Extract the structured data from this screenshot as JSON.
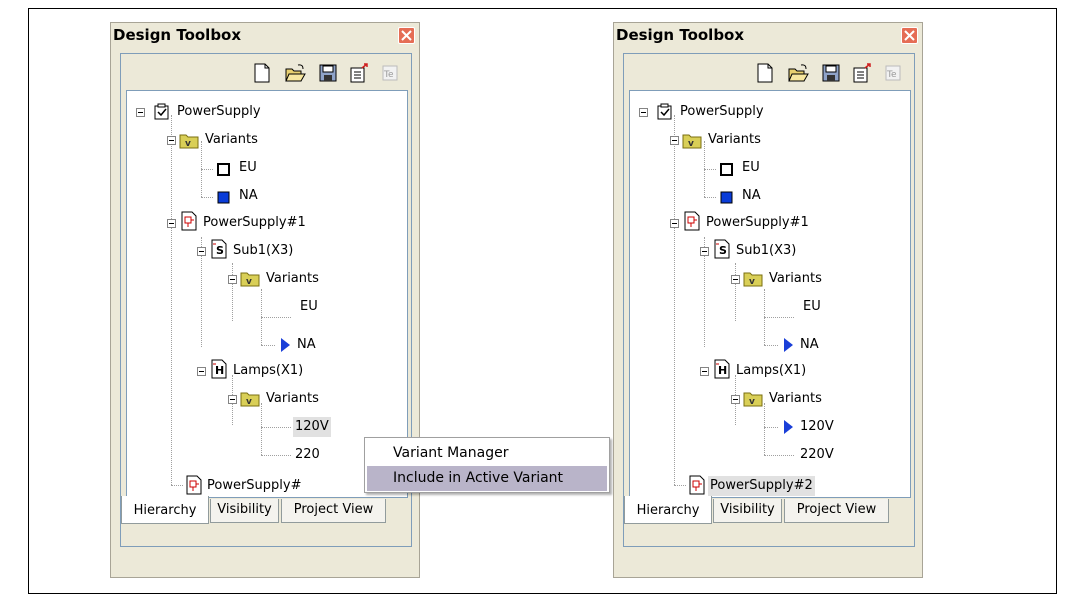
{
  "windows": [
    {
      "title": "Design Toolbox",
      "tree": [
        {
          "label": "PowerSupply",
          "icon": "checkbox-icon"
        },
        {
          "label": "Variants",
          "icon": "variants-folder-icon"
        },
        {
          "label": "EU",
          "icon": "empty-square-icon"
        },
        {
          "label": "NA",
          "icon": "blue-square-icon"
        },
        {
          "label": "PowerSupply#1",
          "icon": "schematic-doc-icon"
        },
        {
          "label": "Sub1(X3)",
          "icon": "sub-sheet-icon"
        },
        {
          "label": "Variants",
          "icon": "variants-folder-icon"
        },
        {
          "label": "EU",
          "icon": ""
        },
        {
          "label": "NA",
          "icon": "active-arrow-icon"
        },
        {
          "label": "Lamps(X1)",
          "icon": "hier-sheet-icon"
        },
        {
          "label": "Variants",
          "icon": "variants-folder-icon"
        },
        {
          "label": "120V",
          "icon": ""
        },
        {
          "label": "220",
          "icon": ""
        },
        {
          "label": "PowerSupply#",
          "icon": "schematic-doc-icon"
        }
      ],
      "tabs": [
        "Hierarchy",
        "Visibility",
        "Project View"
      ]
    },
    {
      "title": "Design Toolbox",
      "tree": [
        {
          "label": "PowerSupply",
          "icon": "checkbox-icon"
        },
        {
          "label": "Variants",
          "icon": "variants-folder-icon"
        },
        {
          "label": "EU",
          "icon": "empty-square-icon"
        },
        {
          "label": "NA",
          "icon": "blue-square-icon"
        },
        {
          "label": "PowerSupply#1",
          "icon": "schematic-doc-icon"
        },
        {
          "label": "Sub1(X3)",
          "icon": "sub-sheet-icon"
        },
        {
          "label": "Variants",
          "icon": "variants-folder-icon"
        },
        {
          "label": "EU",
          "icon": ""
        },
        {
          "label": "NA",
          "icon": "active-arrow-icon"
        },
        {
          "label": "Lamps(X1)",
          "icon": "hier-sheet-icon"
        },
        {
          "label": "Variants",
          "icon": "variants-folder-icon"
        },
        {
          "label": "120V",
          "icon": "active-arrow-icon"
        },
        {
          "label": "220V",
          "icon": ""
        },
        {
          "label": "PowerSupply#2",
          "icon": "schematic-doc-icon"
        }
      ],
      "tabs": [
        "Hierarchy",
        "Visibility",
        "Project View"
      ]
    }
  ],
  "context_menu": {
    "items": [
      "Variant Manager",
      "Include in Active Variant"
    ]
  },
  "toolbar_icons": [
    "new-doc-icon",
    "open-folder-icon",
    "save-icon",
    "export-icon",
    "text-edit-icon"
  ]
}
